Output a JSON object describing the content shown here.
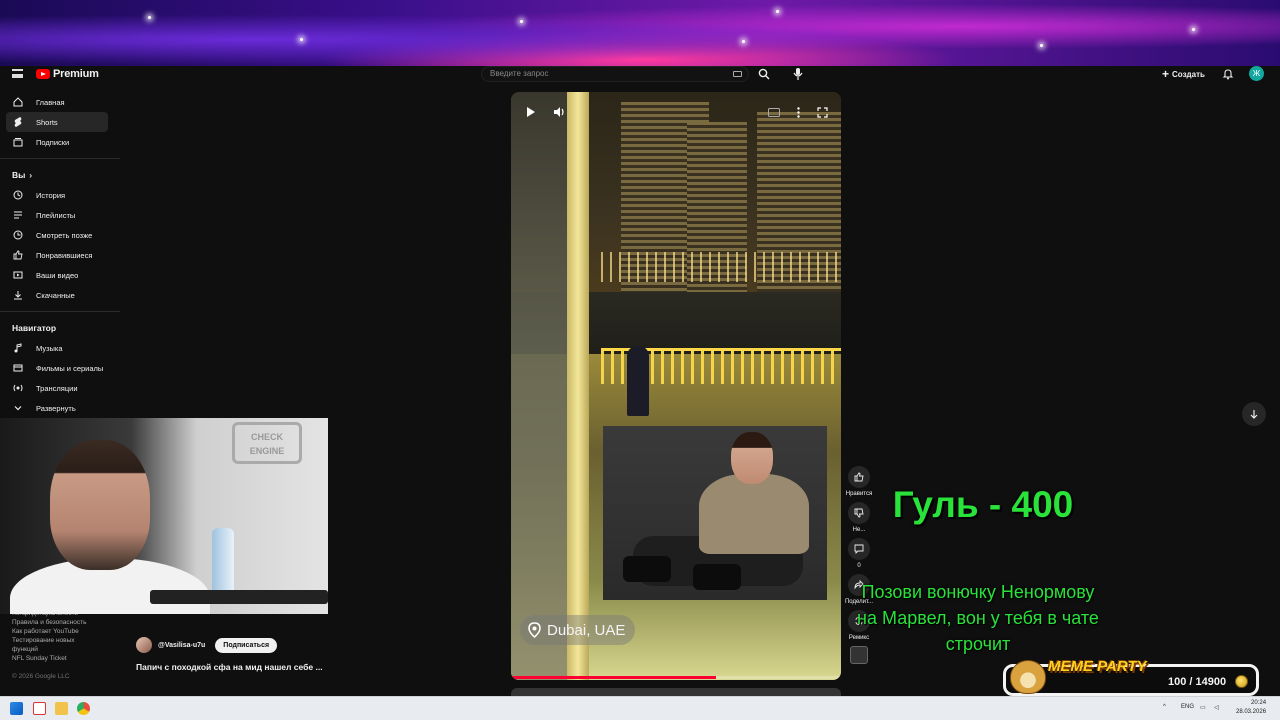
{
  "app": {
    "logo_text": "Premium",
    "search_placeholder": "Введите запрос",
    "create_label": "Создать",
    "avatar_letter": "Ж"
  },
  "sidebar": {
    "main": [
      {
        "label": "Главная",
        "icon": "home-icon"
      },
      {
        "label": "Shorts",
        "icon": "shorts-icon",
        "active": true
      },
      {
        "label": "Подписки",
        "icon": "subscriptions-icon"
      }
    ],
    "you_heading": "Вы",
    "you": [
      {
        "label": "История",
        "icon": "history-icon"
      },
      {
        "label": "Плейлисты",
        "icon": "playlists-icon"
      },
      {
        "label": "Смотреть позже",
        "icon": "watch-later-icon"
      },
      {
        "label": "Понравившиеся",
        "icon": "thumbs-up-icon"
      },
      {
        "label": "Ваши видео",
        "icon": "your-videos-icon"
      },
      {
        "label": "Скачанные",
        "icon": "download-icon"
      }
    ],
    "nav_heading": "Навигатор",
    "nav": [
      {
        "label": "Музыка",
        "icon": "music-icon"
      },
      {
        "label": "Фильмы и сериалы",
        "icon": "movies-icon"
      },
      {
        "label": "Трансляции",
        "icon": "live-icon"
      },
      {
        "label": "Развернуть",
        "icon": "chevron-down-icon"
      }
    ],
    "footer_links": [
      "Конфиденциальность",
      "Правила и безопасность",
      "Как работает YouTube",
      "Тестирование новых",
      "функций",
      "NFL Sunday Ticket"
    ],
    "copyright": "© 2026 Google LLC"
  },
  "webcam": {
    "sign_text_1": "CHECK",
    "sign_text_2": "ENGINE"
  },
  "short": {
    "channel": "@Vasilisa-u7u",
    "subscribe_label": "Подписаться",
    "title": "Папич с походкой сфа на мид нашел себе ...",
    "location": "Dubai, UAE",
    "progress": 0.62
  },
  "actions": {
    "like_label": "Нравится",
    "dislike_label": "Не...",
    "comments_count": "0",
    "share_label": "Поделит...",
    "remix_label": "Ремикс"
  },
  "overlay": {
    "big_text": "Гуль - 400",
    "message_lines": [
      "Позови вонючку Ненормову",
      "на Марвел, вон у тебя в чате",
      "строчит"
    ]
  },
  "meme_widget": {
    "title": "MEME PARTY",
    "counter": "100 / 14900"
  },
  "taskbar": {
    "lang": "ENG",
    "time": "20:24",
    "date": "28.03.2026"
  },
  "colors": {
    "accent_red": "#ff0000",
    "overlay_green": "#29e23a",
    "meme_gold": "#ffd21f"
  }
}
